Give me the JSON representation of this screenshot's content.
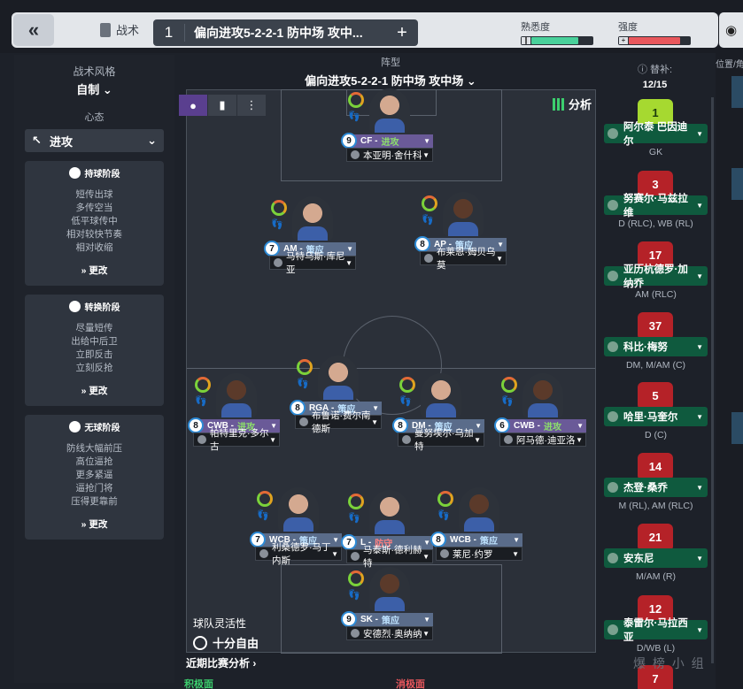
{
  "topbar": {
    "back_label": "«",
    "tactics_label": "战术",
    "tactic_number": "1",
    "tactic_name": "偏向进攻5-2-2-1 防中场 攻中...",
    "add_label": "+",
    "familiarity_label": "熟悉度",
    "intensity_label": "强度",
    "familiarity_fill": 0.78,
    "intensity_fill": 0.85,
    "colors": {
      "familiarity": "#49d19b",
      "intensity": "#e8575c"
    }
  },
  "left": {
    "style_title": "战术风格",
    "style_value": "自制",
    "mentality_title": "心态",
    "mentality_value": "进攻",
    "phases": [
      {
        "title": "持球阶段",
        "items": [
          "短传出球",
          "多传空当",
          "低平球传中",
          "相对较快节奏",
          "相对收缩"
        ],
        "change": "更改"
      },
      {
        "title": "转换阶段",
        "items": [
          "尽量短传",
          "出给中后卫",
          "立即反击",
          "立刻反抢"
        ],
        "change": "更改"
      },
      {
        "title": "无球阶段",
        "items": [
          "防线大幅前压",
          "高位逼抢",
          "更多紧逼",
          "逼抢门将",
          "压得更靠前"
        ],
        "change": "更改"
      }
    ]
  },
  "center": {
    "formation_label": "阵型",
    "formation_name": "偏向进攻5-2-2-1 防中场 攻中场",
    "analyse_label": "分析",
    "flexibility_label": "球队灵活性",
    "flexibility_value": "十分自由",
    "recent_label": "近期比赛分析 ›",
    "positive_label": "积极面",
    "negative_label": "消极面"
  },
  "players": [
    {
      "id": "cf",
      "role": "CF",
      "duty": "进攻",
      "duty_type": "a",
      "num": "9",
      "name": "本亚明·舍什科"
    },
    {
      "id": "aml",
      "role": "AM",
      "duty": "策应",
      "duty_type": "s",
      "num": "7",
      "name": "马特乌斯·库尼亚"
    },
    {
      "id": "amr",
      "role": "AP",
      "duty": "策应",
      "duty_type": "s",
      "num": "8",
      "name": "布莱恩·姆贝乌莫"
    },
    {
      "id": "cwbl",
      "role": "CWB",
      "duty": "进攻",
      "duty_type": "a",
      "num": "8",
      "name": "帕特里克·多尔古"
    },
    {
      "id": "rga",
      "role": "RGA",
      "duty": "策应",
      "duty_type": "s",
      "num": "8",
      "name": "布鲁诺·费尔南德斯"
    },
    {
      "id": "dm",
      "role": "DM",
      "duty": "策应",
      "duty_type": "s",
      "num": "8",
      "name": "曼努埃尔·乌加特"
    },
    {
      "id": "cwbr",
      "role": "CWB",
      "duty": "进攻",
      "duty_type": "a",
      "num": "6",
      "name": "阿马德·迪亚洛"
    },
    {
      "id": "wcbl",
      "role": "WCB",
      "duty": "策应",
      "duty_type": "s",
      "num": "7",
      "name": "利桑德罗·马丁内斯"
    },
    {
      "id": "l",
      "role": "L",
      "duty": "防守",
      "duty_type": "d",
      "num": "7",
      "name": "马泰斯·德利赫特"
    },
    {
      "id": "wcbr",
      "role": "WCB",
      "duty": "策应",
      "duty_type": "s",
      "num": "8",
      "name": "莱尼·约罗"
    },
    {
      "id": "sk",
      "role": "SK",
      "duty": "策应",
      "duty_type": "s",
      "num": "9",
      "name": "安德烈·奥纳纳"
    }
  ],
  "subs": {
    "title": "替补:",
    "count": "12/15",
    "list": [
      {
        "num": "1",
        "name": "阿尔泰 巴因迪尔",
        "pos": "GK",
        "gk": true
      },
      {
        "num": "3",
        "name": "努赛尔·马兹拉维",
        "pos": "D (RLC), WB (RL)"
      },
      {
        "num": "17",
        "name": "亚历杭德罗·加纳乔",
        "pos": "AM (RLC)"
      },
      {
        "num": "37",
        "name": "科比·梅努",
        "pos": "DM, M/AM (C)"
      },
      {
        "num": "5",
        "name": "哈里·马奎尔",
        "pos": "D (C)"
      },
      {
        "num": "14",
        "name": "杰登·桑乔",
        "pos": "M (RL), AM (RLC)"
      },
      {
        "num": "21",
        "name": "安东尼",
        "pos": "M/AM (R)"
      },
      {
        "num": "12",
        "name": "泰雷尔·马拉西亚",
        "pos": "D/WB (L)"
      },
      {
        "num": "7",
        "name": "",
        "pos": ""
      }
    ]
  },
  "right_edge": {
    "label": "位置/角"
  },
  "watermark": "爆 榜 小 组"
}
